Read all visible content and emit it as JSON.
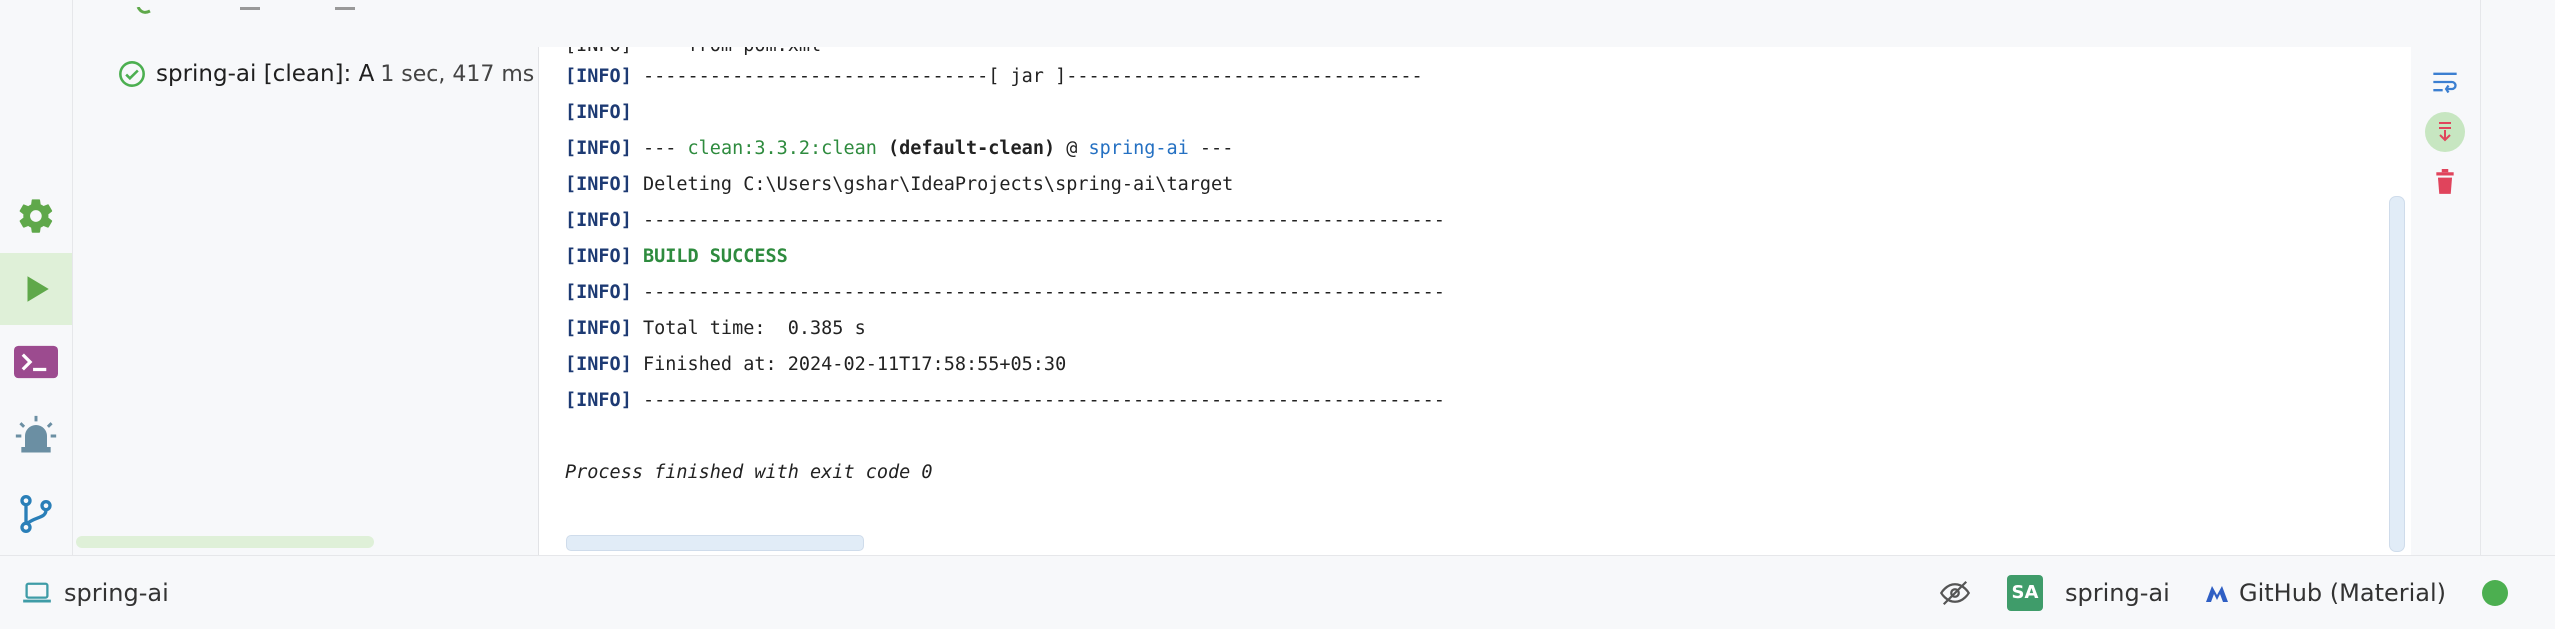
{
  "run_tree": {
    "item_label": "spring-ai [clean]:",
    "item_suffix": "A",
    "item_time": "1 sec, 417 ms"
  },
  "console": {
    "cut_line": "[INFO] --- from pom.xml",
    "lines": {
      "l1_tag": "[INFO]",
      "l1_text": " -------------------------------[ jar ]--------------------------------",
      "l2_tag": "[INFO]",
      "l3_tag": "[INFO]",
      "l3_a": " --- ",
      "l3_plugin": "clean:3.3.2:clean",
      "l3_b": " ",
      "l3_exec": "(default-clean)",
      "l3_c": " @ ",
      "l3_project": "spring-ai",
      "l3_d": " ---",
      "l4_tag": "[INFO]",
      "l4_text": " Deleting C:\\Users\\gshar\\IdeaProjects\\spring-ai\\target",
      "l5_tag": "[INFO]",
      "l5_text": " ------------------------------------------------------------------------",
      "l6_tag": "[INFO]",
      "l6_text": "BUILD SUCCESS",
      "l7_tag": "[INFO]",
      "l7_text": " ------------------------------------------------------------------------",
      "l8_tag": "[INFO]",
      "l8_text": " Total time:  0.385 s",
      "l9_tag": "[INFO]",
      "l9_text": " Finished at: 2024-02-11T17:58:55+05:30",
      "l10_tag": "[INFO]",
      "l10_text": " ------------------------------------------------------------------------",
      "exit": "Process finished with exit code 0"
    }
  },
  "status_bar": {
    "project": "spring-ai",
    "avatar_initials": "SA",
    "user_project": "spring-ai",
    "theme": "GitHub (Material)"
  },
  "colors": {
    "accent_green": "#4caf50",
    "console_tag": "#1d3a73",
    "success": "#2e8b3e",
    "link_blue": "#2470c2"
  }
}
